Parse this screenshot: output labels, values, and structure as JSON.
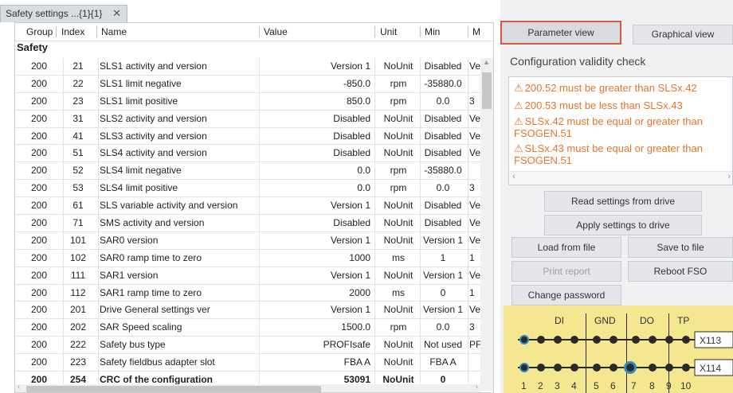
{
  "tab": {
    "title": "Safety settings ...{1}{1}",
    "close": "✕"
  },
  "table": {
    "headers": [
      "Group",
      "Index",
      "Name",
      "Value",
      "Unit",
      "Min",
      "M"
    ],
    "group_label": "Safety",
    "rows": [
      {
        "group": "200",
        "index": "21",
        "name": "SLS1 activity and version",
        "value": "Version 1",
        "unit": "NoUnit",
        "min": "Disabled",
        "max": "Ve"
      },
      {
        "group": "200",
        "index": "22",
        "name": "SLS1 limit negative",
        "value": "-850.0",
        "unit": "rpm",
        "min": "-35880.0",
        "max": ""
      },
      {
        "group": "200",
        "index": "23",
        "name": "SLS1 limit positive",
        "value": "850.0",
        "unit": "rpm",
        "min": "0.0",
        "max": "3"
      },
      {
        "group": "200",
        "index": "31",
        "name": "SLS2 activity and version",
        "value": "Disabled",
        "unit": "NoUnit",
        "min": "Disabled",
        "max": "Ve"
      },
      {
        "group": "200",
        "index": "41",
        "name": "SLS3 activity and version",
        "value": "Disabled",
        "unit": "NoUnit",
        "min": "Disabled",
        "max": "Ve"
      },
      {
        "group": "200",
        "index": "51",
        "name": "SLS4 activity and version",
        "value": "Disabled",
        "unit": "NoUnit",
        "min": "Disabled",
        "max": "Ve"
      },
      {
        "group": "200",
        "index": "52",
        "name": "SLS4 limit negative",
        "value": "0.0",
        "unit": "rpm",
        "min": "-35880.0",
        "max": ""
      },
      {
        "group": "200",
        "index": "53",
        "name": "SLS4 limit positive",
        "value": "0.0",
        "unit": "rpm",
        "min": "0.0",
        "max": "3"
      },
      {
        "group": "200",
        "index": "61",
        "name": "SLS variable activity and version",
        "value": "Version 1",
        "unit": "NoUnit",
        "min": "Disabled",
        "max": "Ve"
      },
      {
        "group": "200",
        "index": "71",
        "name": "SMS activity and version",
        "value": "Disabled",
        "unit": "NoUnit",
        "min": "Disabled",
        "max": "Ve"
      },
      {
        "group": "200",
        "index": "101",
        "name": "SAR0 version",
        "value": "Version 1",
        "unit": "NoUnit",
        "min": "Version 1",
        "max": "Ve"
      },
      {
        "group": "200",
        "index": "102",
        "name": "SAR0 ramp time to zero",
        "value": "1000",
        "unit": "ms",
        "min": "1",
        "max": "1"
      },
      {
        "group": "200",
        "index": "111",
        "name": "SAR1 version",
        "value": "Version 1",
        "unit": "NoUnit",
        "min": "Version 1",
        "max": "Ve"
      },
      {
        "group": "200",
        "index": "112",
        "name": "SAR1 ramp time to zero",
        "value": "2000",
        "unit": "ms",
        "min": "0",
        "max": "1"
      },
      {
        "group": "200",
        "index": "201",
        "name": "Drive General settings ver",
        "value": "Version 1",
        "unit": "NoUnit",
        "min": "Version 1",
        "max": "Ve"
      },
      {
        "group": "200",
        "index": "202",
        "name": "SAR Speed scaling",
        "value": "1500.0",
        "unit": "rpm",
        "min": "0.0",
        "max": "3"
      },
      {
        "group": "200",
        "index": "222",
        "name": "Safety bus type",
        "value": "PROFIsafe",
        "unit": "NoUnit",
        "min": "Not used",
        "max": "PF"
      },
      {
        "group": "200",
        "index": "223",
        "name": "Safety fieldbus adapter slot",
        "value": "FBA A",
        "unit": "NoUnit",
        "min": "FBA A",
        "max": ""
      },
      {
        "group": "200",
        "index": "254",
        "name": "CRC of the configuration",
        "value": "53091",
        "unit": "NoUnit",
        "min": "0",
        "max": ""
      }
    ]
  },
  "right": {
    "view_buttons": {
      "parameter": "Parameter view",
      "graphical": "Graphical view"
    },
    "validity_title": "Configuration validity check",
    "warnings": [
      "200.52 must be greater than SLSx.42",
      "200.53 must be less than SLSx.43",
      "SLSx.42 must be equal or greater than FSOGEN.51",
      "SLSx.43 must be equal or greater than FSOGEN.51"
    ],
    "buttons": {
      "read": "Read settings from drive",
      "apply": "Apply settings to drive",
      "load": "Load from file",
      "save": "Save to file",
      "print": "Print report",
      "reboot": "Reboot FSO",
      "password": "Change password"
    },
    "diagram": {
      "labels": [
        "DI",
        "GND",
        "DO",
        "TP"
      ],
      "connectors": [
        "X113",
        "X114"
      ],
      "pins": [
        "1",
        "2",
        "3",
        "4",
        "5",
        "6",
        "7",
        "8",
        "9",
        "10"
      ],
      "colors": {
        "background": "#f5e690",
        "pin": "#222222",
        "active_ring": "#2a8fc0",
        "warning": "#e8742c"
      }
    }
  }
}
